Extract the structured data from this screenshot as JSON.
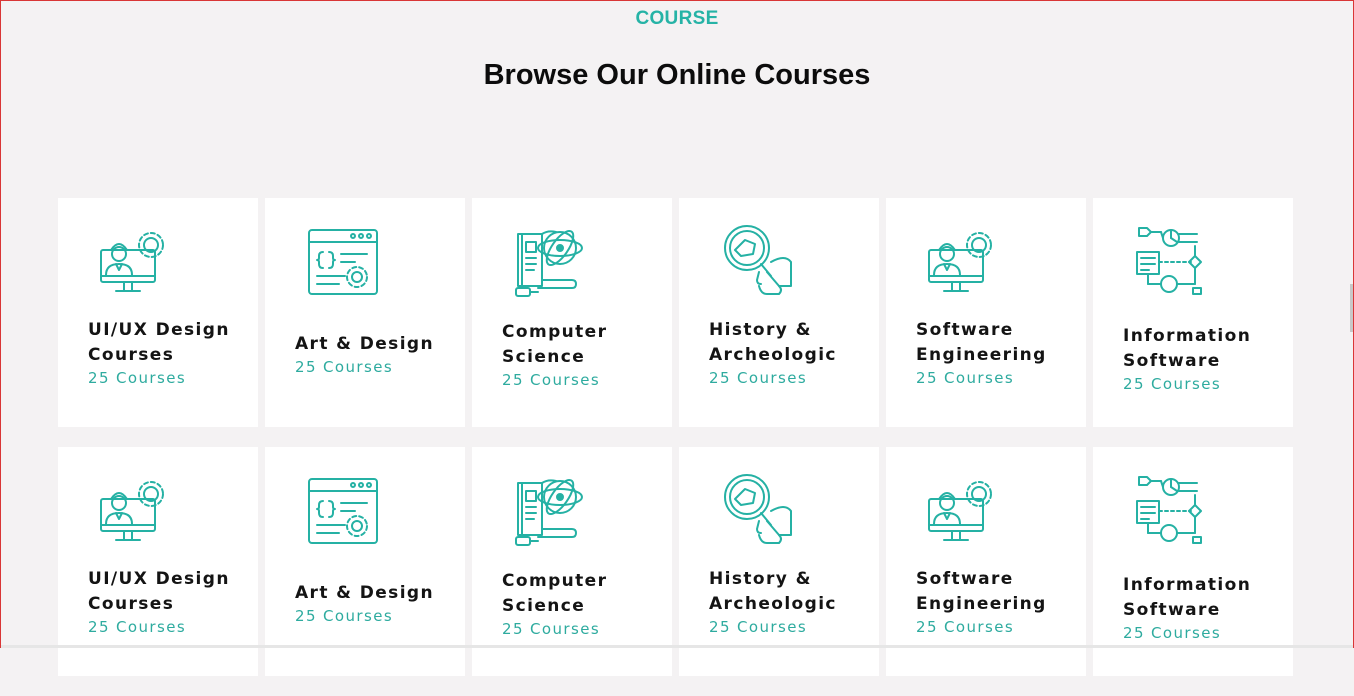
{
  "section": {
    "eyebrow": "COURSE",
    "heading": "Browse Our Online Courses"
  },
  "colors": {
    "accent": "#25b1a4",
    "background": "#f4f2f3",
    "card": "#ffffff",
    "title_text": "#141414"
  },
  "rows": [
    {
      "cards": [
        {
          "title_line1": "UI/UX Design",
          "title_line2": "Courses",
          "count": "25 Courses",
          "icon": "engineer-monitor-gear-icon"
        },
        {
          "title_line1": "Art & Design",
          "title_line2": "",
          "count": "25 Courses",
          "icon": "code-browser-gear-icon"
        },
        {
          "title_line1": "Computer",
          "title_line2": "Science",
          "count": "25 Courses",
          "icon": "book-atom-icon"
        },
        {
          "title_line1": "History &",
          "title_line2": "Archeologic",
          "count": "25 Courses",
          "icon": "magnifier-fossil-icon"
        },
        {
          "title_line1": "Software",
          "title_line2": "Engineering",
          "count": "25 Courses",
          "icon": "engineer-monitor-gear-icon"
        },
        {
          "title_line1": "Information",
          "title_line2": "Software",
          "count": "25 Courses",
          "icon": "flowchart-icon"
        }
      ]
    },
    {
      "cards": [
        {
          "title_line1": "UI/UX Design",
          "title_line2": "Courses",
          "count": "25 Courses",
          "icon": "engineer-monitor-gear-icon"
        },
        {
          "title_line1": "Art & Design",
          "title_line2": "",
          "count": "25 Courses",
          "icon": "code-browser-gear-icon"
        },
        {
          "title_line1": "Computer",
          "title_line2": "Science",
          "count": "25 Courses",
          "icon": "book-atom-icon"
        },
        {
          "title_line1": "History &",
          "title_line2": "Archeologic",
          "count": "25 Courses",
          "icon": "magnifier-fossil-icon"
        },
        {
          "title_line1": "Software",
          "title_line2": "Engineering",
          "count": "25 Courses",
          "icon": "engineer-monitor-gear-icon"
        },
        {
          "title_line1": "Information",
          "title_line2": "Software",
          "count": "25 Courses",
          "icon": "flowchart-icon"
        }
      ]
    }
  ]
}
